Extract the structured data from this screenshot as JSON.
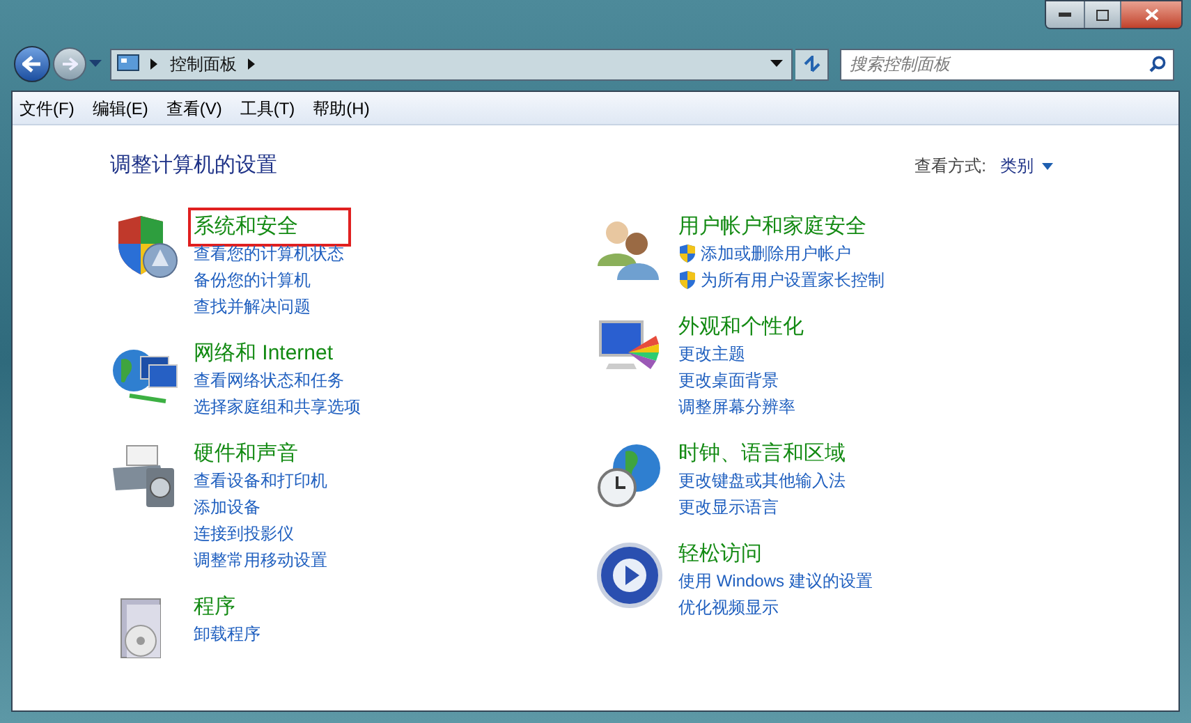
{
  "address_bar": {
    "path": "控制面板"
  },
  "search": {
    "placeholder": "搜索控制面板"
  },
  "menu_bar": [
    "文件(F)",
    "编辑(E)",
    "查看(V)",
    "工具(T)",
    "帮助(H)"
  ],
  "heading": "调整计算机的设置",
  "view_by": {
    "label": "查看方式:",
    "value": "类别"
  },
  "columns": [
    [
      {
        "kind": "security",
        "title": "系统和安全",
        "highlighted": true,
        "links": [
          {
            "text": "查看您的计算机状态",
            "shield": false
          },
          {
            "text": "备份您的计算机",
            "shield": false
          },
          {
            "text": "查找并解决问题",
            "shield": false
          }
        ]
      },
      {
        "kind": "network",
        "title": "网络和 Internet",
        "highlighted": false,
        "links": [
          {
            "text": "查看网络状态和任务",
            "shield": false
          },
          {
            "text": "选择家庭组和共享选项",
            "shield": false
          }
        ]
      },
      {
        "kind": "hardware",
        "title": "硬件和声音",
        "highlighted": false,
        "links": [
          {
            "text": "查看设备和打印机",
            "shield": false
          },
          {
            "text": "添加设备",
            "shield": false
          },
          {
            "text": "连接到投影仪",
            "shield": false
          },
          {
            "text": "调整常用移动设置",
            "shield": false
          }
        ]
      },
      {
        "kind": "programs",
        "title": "程序",
        "highlighted": false,
        "links": [
          {
            "text": "卸载程序",
            "shield": false
          }
        ]
      }
    ],
    [
      {
        "kind": "users",
        "title": "用户帐户和家庭安全",
        "highlighted": false,
        "links": [
          {
            "text": "添加或删除用户帐户",
            "shield": true
          },
          {
            "text": "为所有用户设置家长控制",
            "shield": true
          }
        ]
      },
      {
        "kind": "appearance",
        "title": "外观和个性化",
        "highlighted": false,
        "links": [
          {
            "text": "更改主题",
            "shield": false
          },
          {
            "text": "更改桌面背景",
            "shield": false
          },
          {
            "text": "调整屏幕分辨率",
            "shield": false
          }
        ]
      },
      {
        "kind": "clock",
        "title": "时钟、语言和区域",
        "highlighted": false,
        "links": [
          {
            "text": "更改键盘或其他输入法",
            "shield": false
          },
          {
            "text": "更改显示语言",
            "shield": false
          }
        ]
      },
      {
        "kind": "access",
        "title": "轻松访问",
        "highlighted": false,
        "links": [
          {
            "text": "使用 Windows 建议的设置",
            "shield": false
          },
          {
            "text": "优化视频显示",
            "shield": false
          }
        ]
      }
    ]
  ]
}
